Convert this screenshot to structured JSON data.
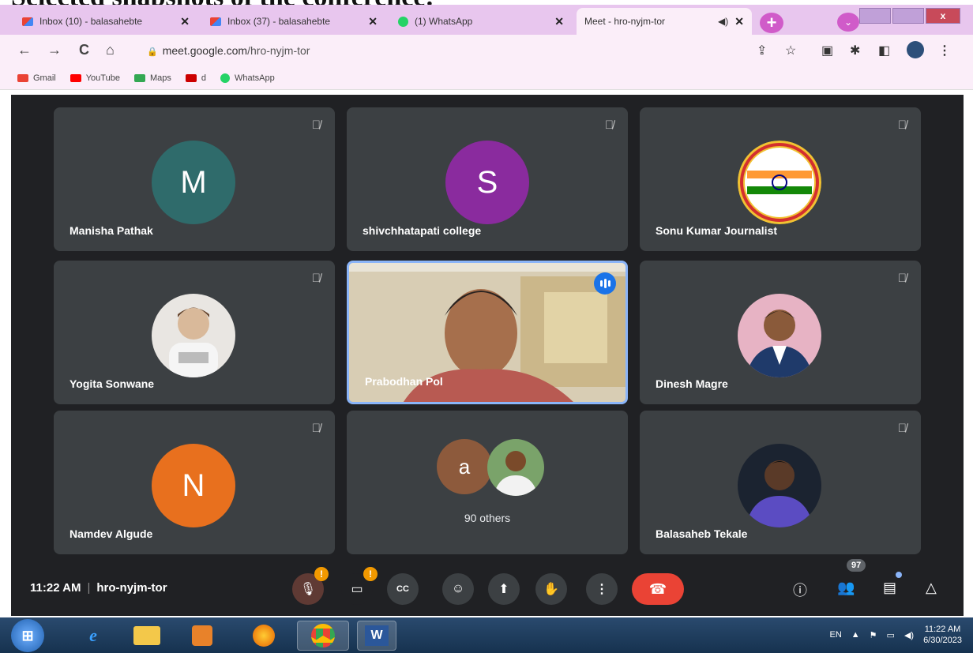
{
  "heading": "Selected snapshots of the conference:",
  "tabs": [
    {
      "title": "Inbox (10) - balasahebte",
      "icon": "gmail-icon"
    },
    {
      "title": "Inbox (37) - balasahebte",
      "icon": "gmail-icon"
    },
    {
      "title": "(1) WhatsApp",
      "icon": "whatsapp-icon"
    },
    {
      "title": "Meet - hro-nyjm-tor",
      "icon": "meet-icon",
      "active": true
    }
  ],
  "address": {
    "domain": "meet.google.com",
    "path": "/hro-nyjm-tor"
  },
  "bookmarks": [
    {
      "label": "Gmail",
      "color": "#ea4335"
    },
    {
      "label": "YouTube",
      "color": "#ff0000"
    },
    {
      "label": "Maps",
      "color": "#34a853"
    },
    {
      "label": "d",
      "color": "#cc0000"
    },
    {
      "label": "WhatsApp",
      "color": "#25d366"
    }
  ],
  "participants": [
    {
      "name": "Manisha Pathak",
      "initial": "M",
      "color": "#2f6b6b"
    },
    {
      "name": "shivchhatapati college",
      "initial": "S",
      "color": "#8a2b9e"
    },
    {
      "name": "Sonu Kumar Journalist",
      "logo": true
    },
    {
      "name": "Yogita Sonwane",
      "photo": true
    },
    {
      "name": "Prabodhan Pol",
      "video": true
    },
    {
      "name": "Dinesh Magre",
      "photo": true
    },
    {
      "name": "Namdev Algude",
      "initial": "N",
      "color": "#e8701e"
    },
    {
      "name": "90 others",
      "group": true,
      "initial": "a",
      "color": "#8d5a3c"
    },
    {
      "name": "Balasaheb Tekale",
      "photo": true
    }
  ],
  "meeting": {
    "time": "11:22 AM",
    "code": "hro-nyjm-tor",
    "people_count": "97"
  },
  "taskbar": {
    "lang": "EN",
    "time": "11:22 AM",
    "date": "6/30/2023"
  },
  "colors": {
    "meet_bg": "#202124",
    "tile_bg": "#3c4043",
    "end_call": "#ea4335",
    "speaking": "#1a73e8"
  }
}
